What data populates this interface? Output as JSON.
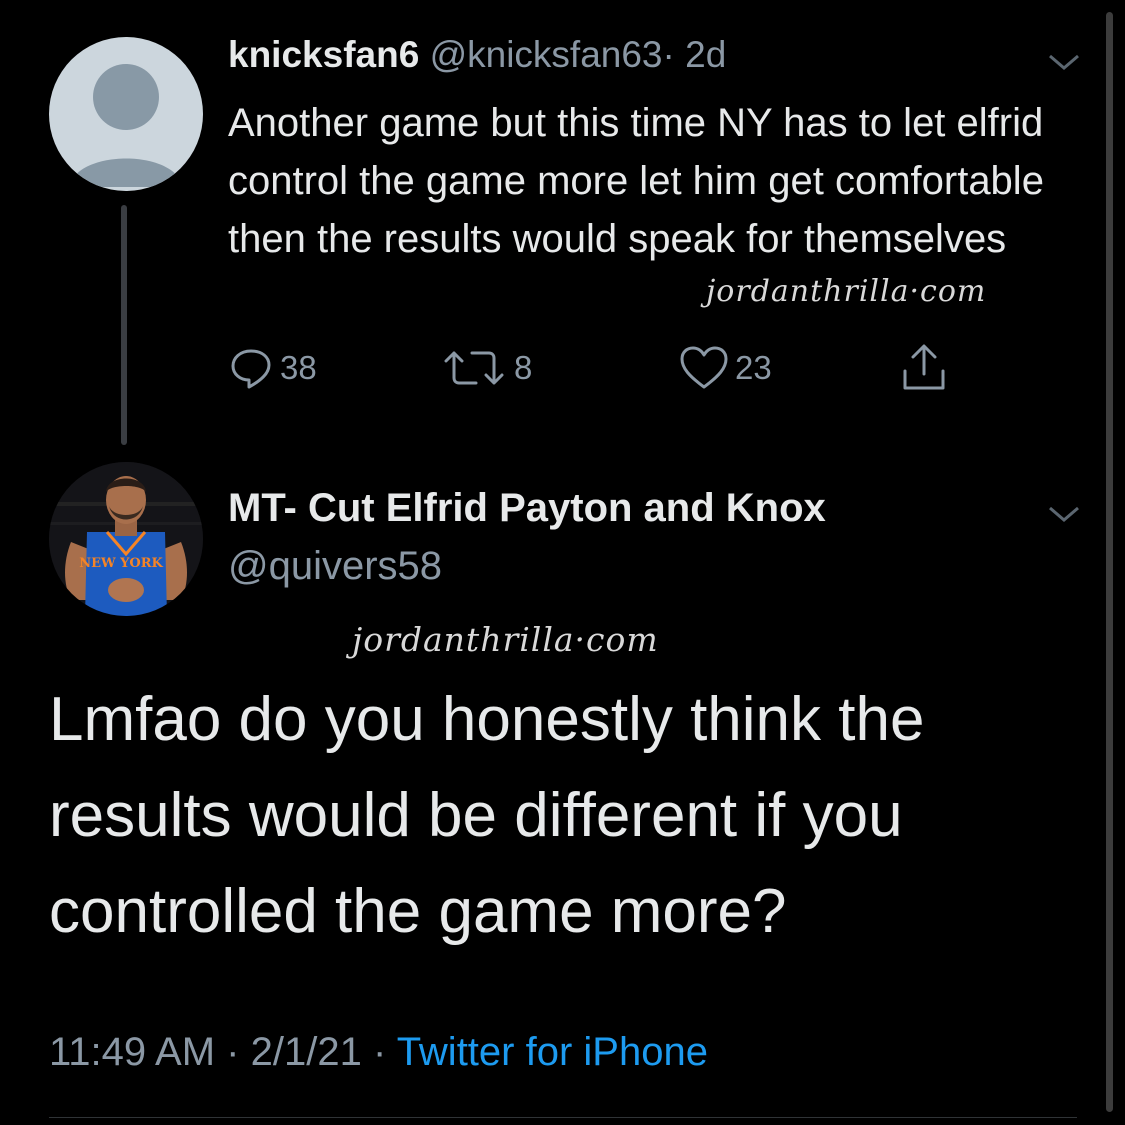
{
  "parent_tweet": {
    "display_name": "knicksfan6",
    "handle": "@knicksfan63",
    "separator": "·",
    "age": "2d",
    "text": "Another game but this time NY has to let elfrid control the game more let him get comfortable then the results would speak for themselves",
    "watermark": "jordanthrilla·com",
    "avatar_icon": "default-avatar-icon",
    "menu_icon": "chevron-down-icon",
    "actions": {
      "reply_count": "38",
      "retweet_count": "8",
      "like_count": "23"
    }
  },
  "main_tweet": {
    "display_name": "MT- Cut Elfrid Payton and Knox",
    "handle": "@quivers58",
    "jersey_text": "NEW YORK",
    "watermark": "jordanthrilla·com",
    "text": "Lmfao do you honestly think the results would be different if you controlled the game more?",
    "time": "11:49 AM",
    "date": "2/1/21",
    "separator": "·",
    "source": "Twitter for iPhone"
  },
  "colors": {
    "background": "#000000",
    "text": "#e7e9ea",
    "muted": "#8b98a5",
    "link": "#1d9bf0"
  }
}
